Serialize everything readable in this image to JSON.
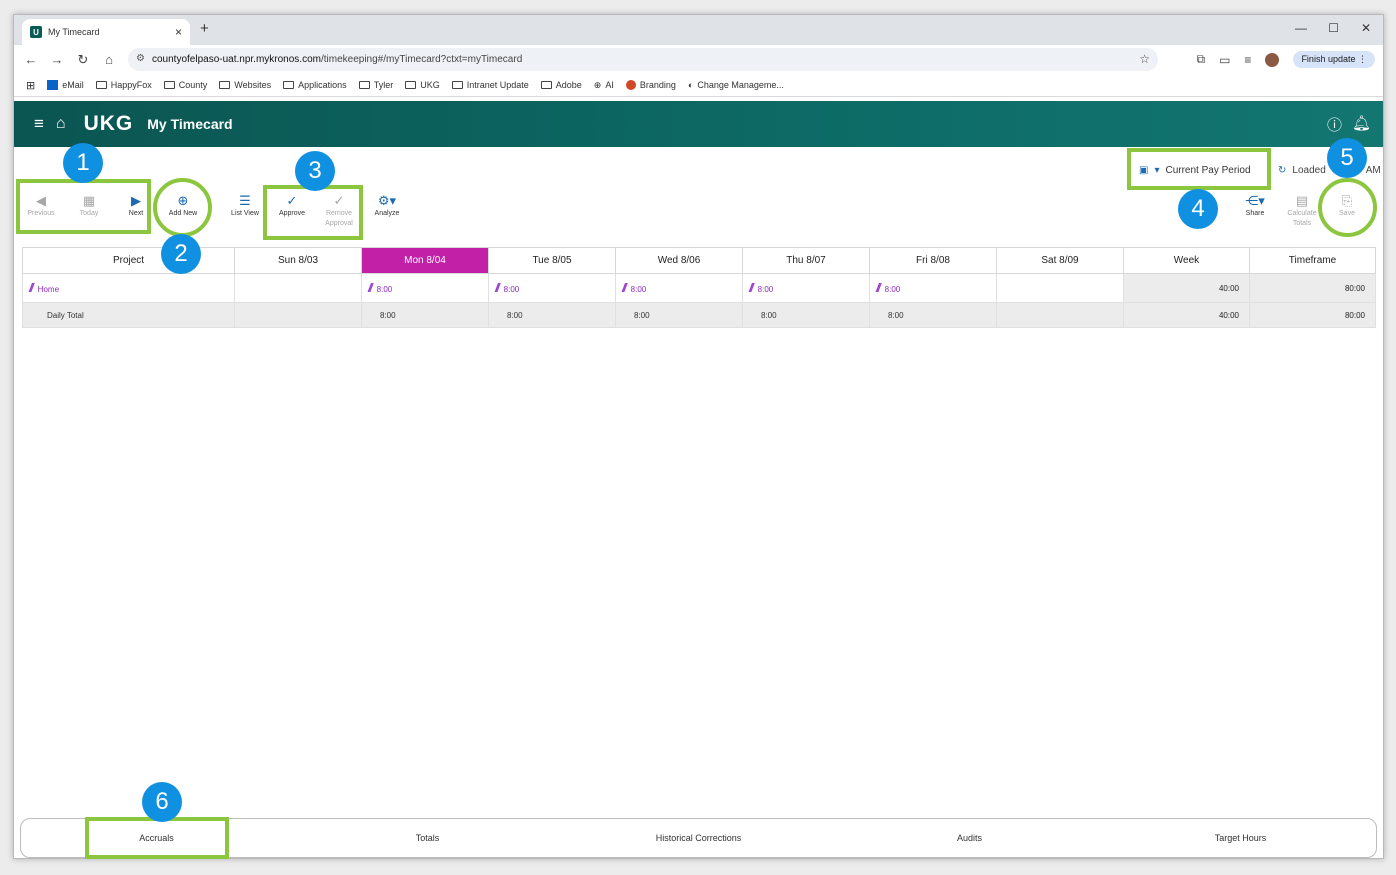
{
  "browser": {
    "tab_title": "My Timecard",
    "url_host": "countyofelpaso-uat.npr.mykronos.com",
    "url_path": "/timekeeping#/myTimecard?ctxt=myTimecard",
    "finish_update": "Finish update",
    "bookmarks": [
      "eMail",
      "HappyFox",
      "County",
      "Websites",
      "Applications",
      "Tyler",
      "UKG",
      "Intranet Update",
      "Adobe",
      "AI",
      "Branding",
      "Change Manageme..."
    ]
  },
  "app": {
    "logo": "UKG",
    "title": "My Timecard"
  },
  "toolbar": {
    "previous": "Previous",
    "today": "Today",
    "next": "Next",
    "add_new": "Add New",
    "list_view": "List View",
    "approve": "Approve",
    "remove_approval_1": "Remove",
    "remove_approval_2": "Approval",
    "analyze": "Analyze",
    "share": "Share",
    "calculate_1": "Calculate",
    "calculate_2": "Totals",
    "save": "Save"
  },
  "pay_period": "Current Pay Period",
  "loaded_text": "Loaded",
  "loaded_suffix": "AM",
  "badges": [
    "1",
    "2",
    "3",
    "4",
    "5",
    "6"
  ],
  "timecard": {
    "columns": [
      "Project",
      "Sun 8/03",
      "Mon 8/04",
      "Tue 8/05",
      "Wed 8/06",
      "Thu 8/07",
      "Fri 8/08",
      "Sat 8/09",
      "Week",
      "Timeframe"
    ],
    "home_row": {
      "label": "Home",
      "mon": "8:00",
      "tue": "8:00",
      "wed": "8:00",
      "thu": "8:00",
      "fri": "8:00",
      "week": "40:00",
      "timeframe": "80:00"
    },
    "total_row": {
      "label": "Daily Total",
      "mon": "8:00",
      "tue": "8:00",
      "wed": "8:00",
      "thu": "8:00",
      "fri": "8:00",
      "week": "40:00",
      "timeframe": "80:00"
    }
  },
  "bottom_tabs": [
    "Accruals",
    "Totals",
    "Historical Corrections",
    "Audits",
    "Target Hours"
  ],
  "colors": {
    "header": "#0d6b66",
    "today_column": "#c320a8",
    "highlight": "#8cc63f",
    "badge": "#1090e0"
  }
}
